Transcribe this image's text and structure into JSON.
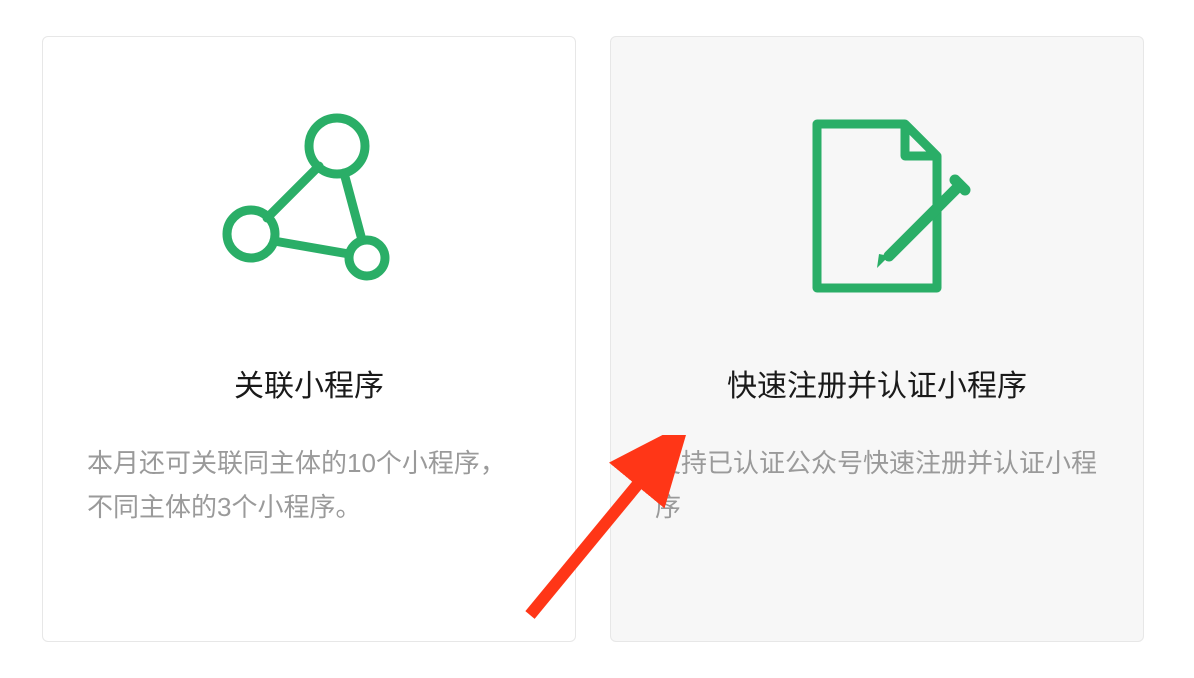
{
  "cards": [
    {
      "title": "关联小程序",
      "desc": "本月还可关联同主体的10个小程序，不同主体的3个小程序。"
    },
    {
      "title": "快速注册并认证小程序",
      "desc": "支持已认证公众号快速注册并认证小程序"
    }
  ],
  "colors": {
    "accent": "#2aae67"
  }
}
